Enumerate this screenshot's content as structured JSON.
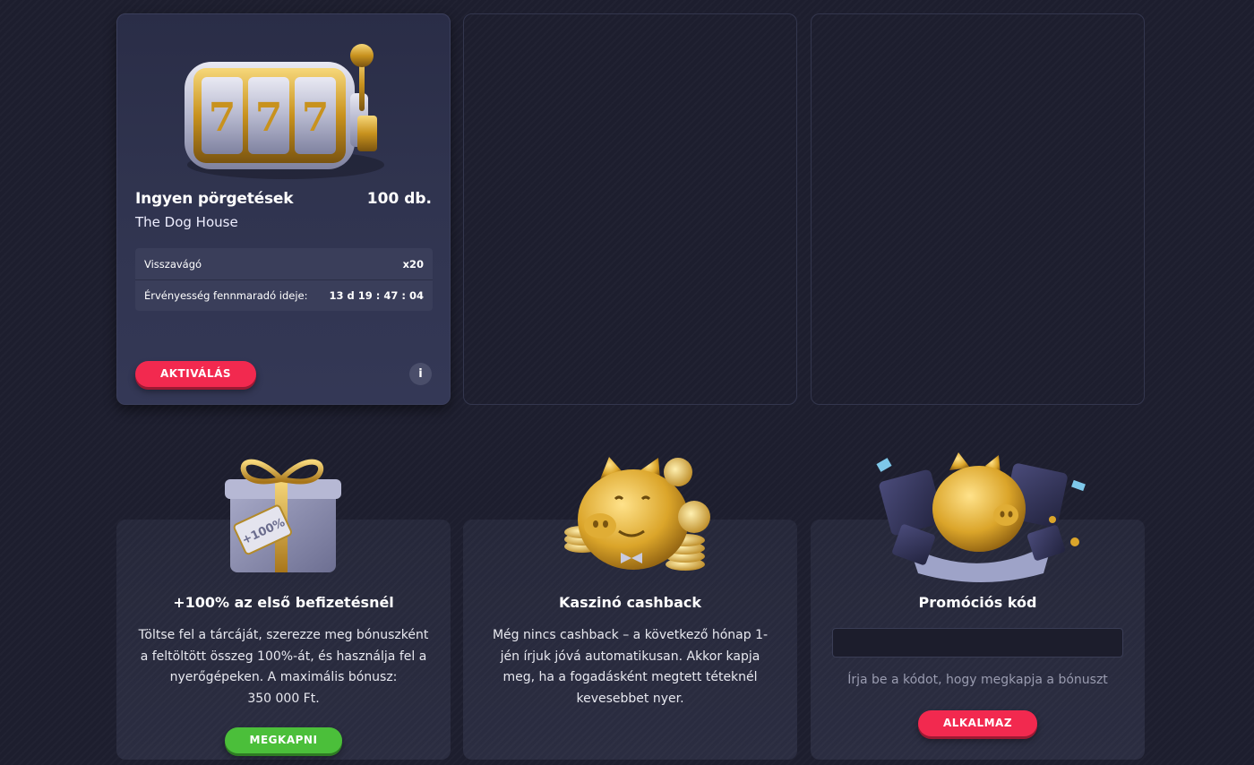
{
  "free_spins_card": {
    "title": "Ingyen pörgetések",
    "count": "100 db.",
    "game": "The Dog House",
    "rows": [
      {
        "label": "Visszavágó",
        "value": "x20"
      },
      {
        "label": "Érvényesség fennmaradó ideje:",
        "value": "13 d 19 : 47 : 04"
      }
    ],
    "activate_label": "AKTIVÁLÁS",
    "info_label": "i"
  },
  "promos": {
    "deposit": {
      "title": "+100% az első befizetésnél",
      "text_lines": [
        "Töltse fel a tárcáját, szerezze meg bónuszként",
        "a feltöltött összeg 100%-át, és használja fel a",
        "nyerőgépeken. A maximális bónusz:",
        "350 000 Ft."
      ],
      "button_label": "MEGKAPNI",
      "tag_text": "+100%"
    },
    "cashback": {
      "title": "Kaszinó cashback",
      "text_lines": [
        "Még nincs cashback – a következő hónap 1-",
        "jén írjuk jóvá automatikusan. Akkor kapja",
        "meg, ha a fogadásként megtett téteknél",
        "kevesebbet nyer."
      ]
    },
    "promo_code": {
      "title": "Promóciós kód",
      "input_value": "",
      "hint": "Írja be a kódot, hogy megkapja a bónuszt",
      "button_label": "ALKALMAZ"
    }
  },
  "colors": {
    "background": "#1d1e2e",
    "accent_red": "#f2294f",
    "accent_green": "#4bbf3a",
    "gold": "#d9a92a"
  }
}
